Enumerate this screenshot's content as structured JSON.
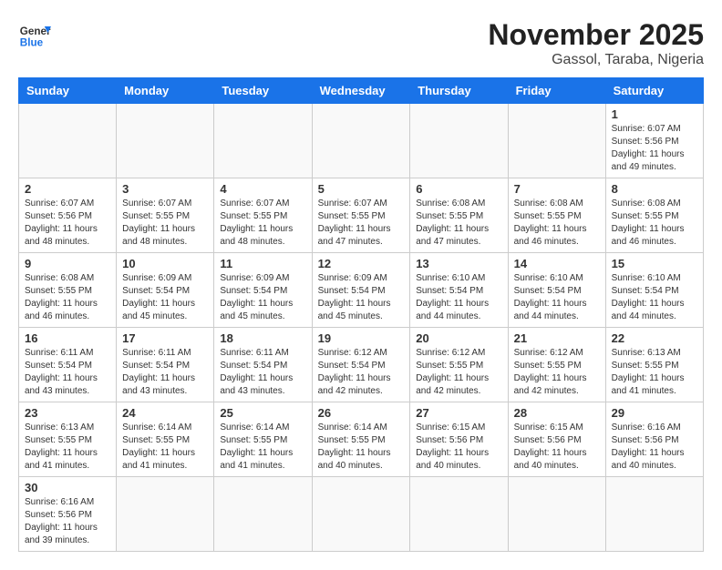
{
  "header": {
    "logo_general": "General",
    "logo_blue": "Blue",
    "month_year": "November 2025",
    "location": "Gassol, Taraba, Nigeria"
  },
  "days_of_week": [
    "Sunday",
    "Monday",
    "Tuesday",
    "Wednesday",
    "Thursday",
    "Friday",
    "Saturday"
  ],
  "weeks": [
    [
      {
        "day": "",
        "info": ""
      },
      {
        "day": "",
        "info": ""
      },
      {
        "day": "",
        "info": ""
      },
      {
        "day": "",
        "info": ""
      },
      {
        "day": "",
        "info": ""
      },
      {
        "day": "",
        "info": ""
      },
      {
        "day": "1",
        "info": "Sunrise: 6:07 AM\nSunset: 5:56 PM\nDaylight: 11 hours and 49 minutes."
      }
    ],
    [
      {
        "day": "2",
        "info": "Sunrise: 6:07 AM\nSunset: 5:56 PM\nDaylight: 11 hours and 48 minutes."
      },
      {
        "day": "3",
        "info": "Sunrise: 6:07 AM\nSunset: 5:55 PM\nDaylight: 11 hours and 48 minutes."
      },
      {
        "day": "4",
        "info": "Sunrise: 6:07 AM\nSunset: 5:55 PM\nDaylight: 11 hours and 48 minutes."
      },
      {
        "day": "5",
        "info": "Sunrise: 6:07 AM\nSunset: 5:55 PM\nDaylight: 11 hours and 47 minutes."
      },
      {
        "day": "6",
        "info": "Sunrise: 6:08 AM\nSunset: 5:55 PM\nDaylight: 11 hours and 47 minutes."
      },
      {
        "day": "7",
        "info": "Sunrise: 6:08 AM\nSunset: 5:55 PM\nDaylight: 11 hours and 46 minutes."
      },
      {
        "day": "8",
        "info": "Sunrise: 6:08 AM\nSunset: 5:55 PM\nDaylight: 11 hours and 46 minutes."
      }
    ],
    [
      {
        "day": "9",
        "info": "Sunrise: 6:08 AM\nSunset: 5:55 PM\nDaylight: 11 hours and 46 minutes."
      },
      {
        "day": "10",
        "info": "Sunrise: 6:09 AM\nSunset: 5:54 PM\nDaylight: 11 hours and 45 minutes."
      },
      {
        "day": "11",
        "info": "Sunrise: 6:09 AM\nSunset: 5:54 PM\nDaylight: 11 hours and 45 minutes."
      },
      {
        "day": "12",
        "info": "Sunrise: 6:09 AM\nSunset: 5:54 PM\nDaylight: 11 hours and 45 minutes."
      },
      {
        "day": "13",
        "info": "Sunrise: 6:10 AM\nSunset: 5:54 PM\nDaylight: 11 hours and 44 minutes."
      },
      {
        "day": "14",
        "info": "Sunrise: 6:10 AM\nSunset: 5:54 PM\nDaylight: 11 hours and 44 minutes."
      },
      {
        "day": "15",
        "info": "Sunrise: 6:10 AM\nSunset: 5:54 PM\nDaylight: 11 hours and 44 minutes."
      }
    ],
    [
      {
        "day": "16",
        "info": "Sunrise: 6:11 AM\nSunset: 5:54 PM\nDaylight: 11 hours and 43 minutes."
      },
      {
        "day": "17",
        "info": "Sunrise: 6:11 AM\nSunset: 5:54 PM\nDaylight: 11 hours and 43 minutes."
      },
      {
        "day": "18",
        "info": "Sunrise: 6:11 AM\nSunset: 5:54 PM\nDaylight: 11 hours and 43 minutes."
      },
      {
        "day": "19",
        "info": "Sunrise: 6:12 AM\nSunset: 5:54 PM\nDaylight: 11 hours and 42 minutes."
      },
      {
        "day": "20",
        "info": "Sunrise: 6:12 AM\nSunset: 5:55 PM\nDaylight: 11 hours and 42 minutes."
      },
      {
        "day": "21",
        "info": "Sunrise: 6:12 AM\nSunset: 5:55 PM\nDaylight: 11 hours and 42 minutes."
      },
      {
        "day": "22",
        "info": "Sunrise: 6:13 AM\nSunset: 5:55 PM\nDaylight: 11 hours and 41 minutes."
      }
    ],
    [
      {
        "day": "23",
        "info": "Sunrise: 6:13 AM\nSunset: 5:55 PM\nDaylight: 11 hours and 41 minutes."
      },
      {
        "day": "24",
        "info": "Sunrise: 6:14 AM\nSunset: 5:55 PM\nDaylight: 11 hours and 41 minutes."
      },
      {
        "day": "25",
        "info": "Sunrise: 6:14 AM\nSunset: 5:55 PM\nDaylight: 11 hours and 41 minutes."
      },
      {
        "day": "26",
        "info": "Sunrise: 6:14 AM\nSunset: 5:55 PM\nDaylight: 11 hours and 40 minutes."
      },
      {
        "day": "27",
        "info": "Sunrise: 6:15 AM\nSunset: 5:56 PM\nDaylight: 11 hours and 40 minutes."
      },
      {
        "day": "28",
        "info": "Sunrise: 6:15 AM\nSunset: 5:56 PM\nDaylight: 11 hours and 40 minutes."
      },
      {
        "day": "29",
        "info": "Sunrise: 6:16 AM\nSunset: 5:56 PM\nDaylight: 11 hours and 40 minutes."
      }
    ],
    [
      {
        "day": "30",
        "info": "Sunrise: 6:16 AM\nSunset: 5:56 PM\nDaylight: 11 hours and 39 minutes."
      },
      {
        "day": "",
        "info": ""
      },
      {
        "day": "",
        "info": ""
      },
      {
        "day": "",
        "info": ""
      },
      {
        "day": "",
        "info": ""
      },
      {
        "day": "",
        "info": ""
      },
      {
        "day": "",
        "info": ""
      }
    ]
  ]
}
